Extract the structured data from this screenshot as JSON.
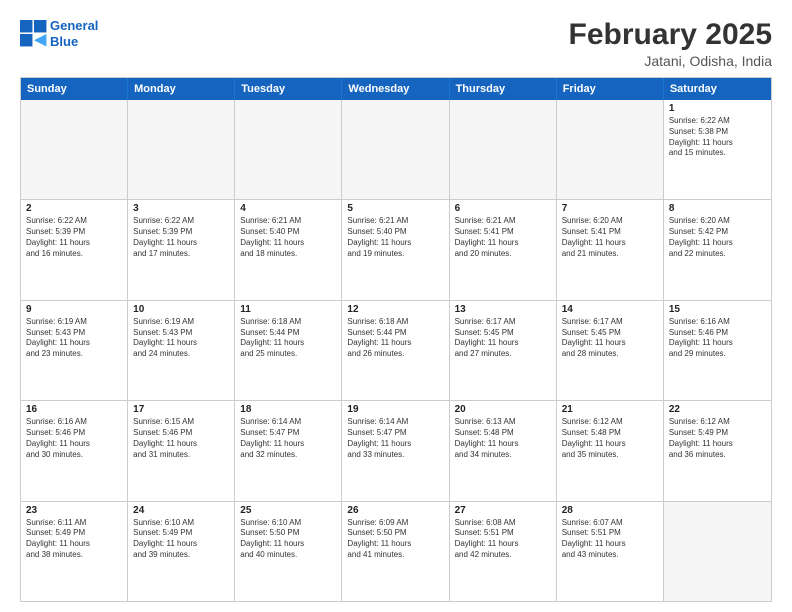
{
  "header": {
    "logo_line1": "General",
    "logo_line2": "Blue",
    "month_title": "February 2025",
    "location": "Jatani, Odisha, India"
  },
  "weekdays": [
    "Sunday",
    "Monday",
    "Tuesday",
    "Wednesday",
    "Thursday",
    "Friday",
    "Saturday"
  ],
  "rows": [
    [
      {
        "day": "",
        "text": ""
      },
      {
        "day": "",
        "text": ""
      },
      {
        "day": "",
        "text": ""
      },
      {
        "day": "",
        "text": ""
      },
      {
        "day": "",
        "text": ""
      },
      {
        "day": "",
        "text": ""
      },
      {
        "day": "1",
        "text": "Sunrise: 6:22 AM\nSunset: 5:38 PM\nDaylight: 11 hours\nand 15 minutes."
      }
    ],
    [
      {
        "day": "2",
        "text": "Sunrise: 6:22 AM\nSunset: 5:39 PM\nDaylight: 11 hours\nand 16 minutes."
      },
      {
        "day": "3",
        "text": "Sunrise: 6:22 AM\nSunset: 5:39 PM\nDaylight: 11 hours\nand 17 minutes."
      },
      {
        "day": "4",
        "text": "Sunrise: 6:21 AM\nSunset: 5:40 PM\nDaylight: 11 hours\nand 18 minutes."
      },
      {
        "day": "5",
        "text": "Sunrise: 6:21 AM\nSunset: 5:40 PM\nDaylight: 11 hours\nand 19 minutes."
      },
      {
        "day": "6",
        "text": "Sunrise: 6:21 AM\nSunset: 5:41 PM\nDaylight: 11 hours\nand 20 minutes."
      },
      {
        "day": "7",
        "text": "Sunrise: 6:20 AM\nSunset: 5:41 PM\nDaylight: 11 hours\nand 21 minutes."
      },
      {
        "day": "8",
        "text": "Sunrise: 6:20 AM\nSunset: 5:42 PM\nDaylight: 11 hours\nand 22 minutes."
      }
    ],
    [
      {
        "day": "9",
        "text": "Sunrise: 6:19 AM\nSunset: 5:43 PM\nDaylight: 11 hours\nand 23 minutes."
      },
      {
        "day": "10",
        "text": "Sunrise: 6:19 AM\nSunset: 5:43 PM\nDaylight: 11 hours\nand 24 minutes."
      },
      {
        "day": "11",
        "text": "Sunrise: 6:18 AM\nSunset: 5:44 PM\nDaylight: 11 hours\nand 25 minutes."
      },
      {
        "day": "12",
        "text": "Sunrise: 6:18 AM\nSunset: 5:44 PM\nDaylight: 11 hours\nand 26 minutes."
      },
      {
        "day": "13",
        "text": "Sunrise: 6:17 AM\nSunset: 5:45 PM\nDaylight: 11 hours\nand 27 minutes."
      },
      {
        "day": "14",
        "text": "Sunrise: 6:17 AM\nSunset: 5:45 PM\nDaylight: 11 hours\nand 28 minutes."
      },
      {
        "day": "15",
        "text": "Sunrise: 6:16 AM\nSunset: 5:46 PM\nDaylight: 11 hours\nand 29 minutes."
      }
    ],
    [
      {
        "day": "16",
        "text": "Sunrise: 6:16 AM\nSunset: 5:46 PM\nDaylight: 11 hours\nand 30 minutes."
      },
      {
        "day": "17",
        "text": "Sunrise: 6:15 AM\nSunset: 5:46 PM\nDaylight: 11 hours\nand 31 minutes."
      },
      {
        "day": "18",
        "text": "Sunrise: 6:14 AM\nSunset: 5:47 PM\nDaylight: 11 hours\nand 32 minutes."
      },
      {
        "day": "19",
        "text": "Sunrise: 6:14 AM\nSunset: 5:47 PM\nDaylight: 11 hours\nand 33 minutes."
      },
      {
        "day": "20",
        "text": "Sunrise: 6:13 AM\nSunset: 5:48 PM\nDaylight: 11 hours\nand 34 minutes."
      },
      {
        "day": "21",
        "text": "Sunrise: 6:12 AM\nSunset: 5:48 PM\nDaylight: 11 hours\nand 35 minutes."
      },
      {
        "day": "22",
        "text": "Sunrise: 6:12 AM\nSunset: 5:49 PM\nDaylight: 11 hours\nand 36 minutes."
      }
    ],
    [
      {
        "day": "23",
        "text": "Sunrise: 6:11 AM\nSunset: 5:49 PM\nDaylight: 11 hours\nand 38 minutes."
      },
      {
        "day": "24",
        "text": "Sunrise: 6:10 AM\nSunset: 5:49 PM\nDaylight: 11 hours\nand 39 minutes."
      },
      {
        "day": "25",
        "text": "Sunrise: 6:10 AM\nSunset: 5:50 PM\nDaylight: 11 hours\nand 40 minutes."
      },
      {
        "day": "26",
        "text": "Sunrise: 6:09 AM\nSunset: 5:50 PM\nDaylight: 11 hours\nand 41 minutes."
      },
      {
        "day": "27",
        "text": "Sunrise: 6:08 AM\nSunset: 5:51 PM\nDaylight: 11 hours\nand 42 minutes."
      },
      {
        "day": "28",
        "text": "Sunrise: 6:07 AM\nSunset: 5:51 PM\nDaylight: 11 hours\nand 43 minutes."
      },
      {
        "day": "",
        "text": ""
      }
    ]
  ]
}
